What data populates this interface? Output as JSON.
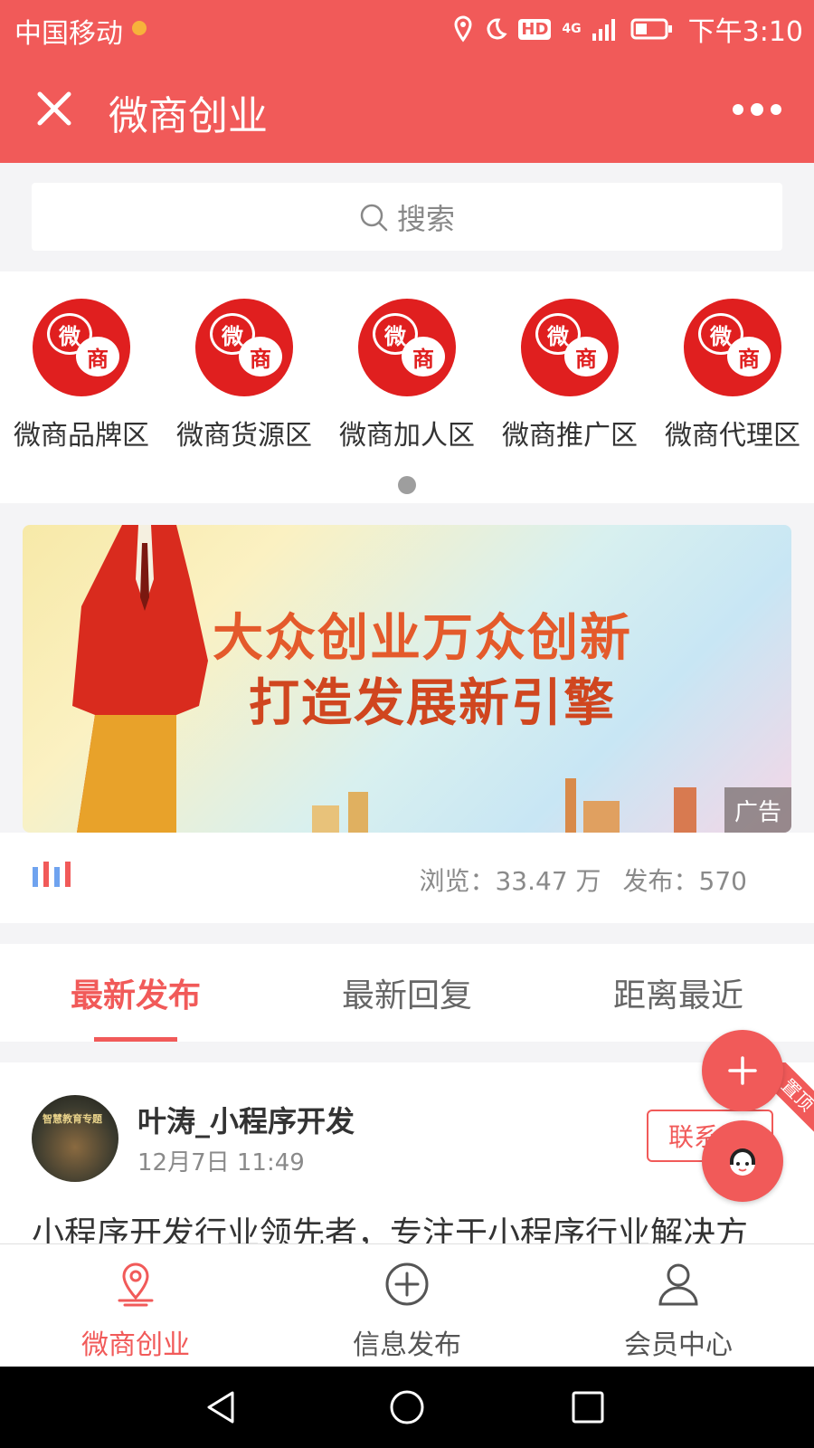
{
  "status_bar": {
    "carrier": "中国移动",
    "hd_label": "HD",
    "network_label": "4G",
    "time": "下午3:10"
  },
  "nav": {
    "title": "微商创业"
  },
  "search": {
    "placeholder": "搜索"
  },
  "categories": [
    {
      "label": "微商品牌区",
      "logo_top": "微",
      "logo_bottom": "商"
    },
    {
      "label": "微商货源区",
      "logo_top": "微",
      "logo_bottom": "商"
    },
    {
      "label": "微商加人区",
      "logo_top": "微",
      "logo_bottom": "商"
    },
    {
      "label": "微商推广区",
      "logo_top": "微",
      "logo_bottom": "商"
    },
    {
      "label": "微商代理区",
      "logo_top": "微",
      "logo_bottom": "商"
    }
  ],
  "banner": {
    "line1": "大众创业万众创新",
    "line2": "打造发展新引擎",
    "ad_tag": "广告"
  },
  "stats": {
    "views_label": "浏览：",
    "views_value": "33.47 万",
    "posts_label": "发布：",
    "posts_value": "570"
  },
  "tabs": [
    {
      "label": "最新发布",
      "active": true
    },
    {
      "label": "最新回复",
      "active": false
    },
    {
      "label": "距离最近",
      "active": false
    }
  ],
  "post": {
    "author": "叶涛_小程序开发",
    "date": "12月7日 11:49",
    "contact_label": "联系",
    "pin_label": "置顶",
    "text": "小程序开发行业领先者，专注于小程序行业解决方",
    "avatar_caption": "智慧教育专题"
  },
  "bottom_nav": [
    {
      "label": "微商创业",
      "icon": "location-icon",
      "active": true
    },
    {
      "label": "信息发布",
      "icon": "plus-circle-icon",
      "active": false
    },
    {
      "label": "会员中心",
      "icon": "user-icon",
      "active": false
    }
  ],
  "colors": {
    "primary": "#f15a59",
    "logo_red": "#e01f1f"
  }
}
